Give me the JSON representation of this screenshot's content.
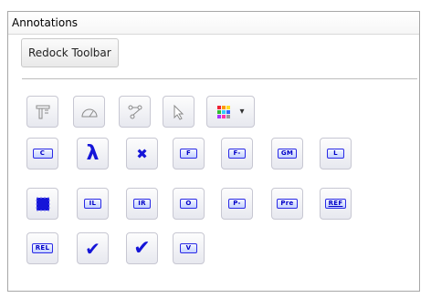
{
  "panel": {
    "title": "Annotations",
    "redock_label": "Redock Toolbar"
  },
  "toolbar_row1": [
    {
      "name": "paragraph-style-icon",
      "glyph": "¶"
    },
    {
      "name": "measure-gauge-icon",
      "glyph": "◒"
    },
    {
      "name": "node-path-icon",
      "glyph": "⤳"
    },
    {
      "name": "pointer-cursor-icon",
      "glyph": "⇖"
    },
    {
      "name": "color-palette-icon",
      "glyph": "▦",
      "dropdown": "▾"
    }
  ],
  "tag_buttons": {
    "C": "C",
    "F": "F",
    "Fminus": "F-",
    "GM": "GM",
    "L": "L",
    "IL": "IL",
    "IR": "IR",
    "O": "O",
    "Pminus": "P-",
    "Pre": "Pre",
    "REF": "REF",
    "REL": "REL",
    "V": "V"
  },
  "icons": {
    "lambda": "λ",
    "cross": "✖",
    "check": "✔",
    "dropdown": "▾"
  }
}
